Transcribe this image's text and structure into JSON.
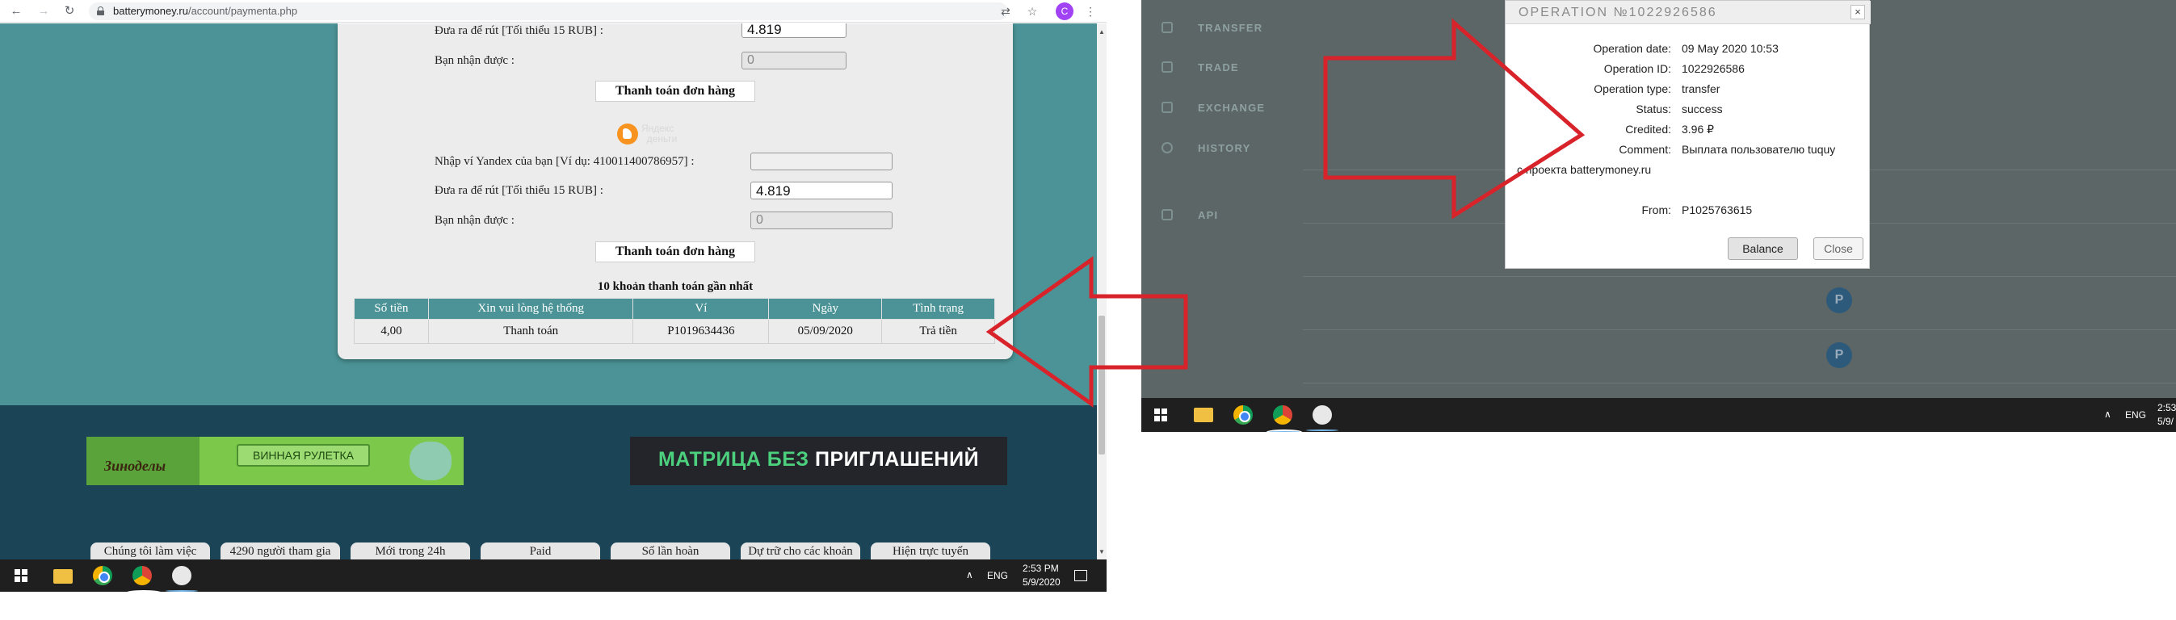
{
  "left_screen": {
    "browser": {
      "url_host": "batterymoney.ru",
      "url_path": "/account/paymenta.php",
      "profile_initial": "C"
    },
    "form_top": {
      "withdraw_label": "Đưa ra để rút [Tối thiểu 15 RUB] :",
      "withdraw_value": "4.819",
      "receive_label": "Bạn nhận được :",
      "receive_value": "0",
      "pay_button": "Thanh toán đơn hàng"
    },
    "yandex": {
      "logo_line1": "Яндекс",
      "logo_line2": "деньги",
      "wallet_label": "Nhập ví Yandex của bạn [Ví dụ: 410011400786957] :",
      "wallet_value": "",
      "withdraw_label": "Đưa ra để rút [Tối thiểu 15 RUB] :",
      "withdraw_value": "4.819",
      "receive_label": "Bạn nhận được :",
      "receive_value": "0",
      "pay_button": "Thanh toán đơn hàng"
    },
    "recent": {
      "title": "10 khoản thanh toán gần nhất",
      "columns": [
        "Số tiền",
        "Xin vui lòng hệ thống",
        "Ví",
        "Ngày",
        "Tình trạng"
      ],
      "rows": [
        [
          "4,00",
          "Thanh toán",
          "P1019634436",
          "05/09/2020",
          "Trả tiền"
        ]
      ]
    },
    "banners": {
      "b1_logo": "Зиноделы",
      "b1_button": "ВИННАЯ РУЛЕТКА",
      "b2_part1": "МАТРИЦА БЕЗ ",
      "b2_part2": "ПРИГЛАШЕНИЙ"
    },
    "footer_tabs": [
      "Chúng tôi làm việc",
      "4290 người tham gia",
      "Mới trong 24h",
      "Paid",
      "Số lần hoàn",
      "Dự trữ cho các khoản",
      "Hiện trực tuyến"
    ],
    "taskbar": {
      "lang": "ENG",
      "time": "2:53 PM",
      "date": "5/9/2020"
    }
  },
  "right_screen": {
    "sidebar": [
      "TRANSFER",
      "TRADE",
      "EXCHANGE",
      "HISTORY",
      "API"
    ],
    "modal": {
      "title": "OPERATION №1022926586",
      "close_glyph": "×",
      "fields": [
        {
          "label": "Operation date:",
          "value": "09 May 2020 10:53"
        },
        {
          "label": "Operation ID:",
          "value": "1022926586"
        },
        {
          "label": "Operation type:",
          "value": "transfer"
        },
        {
          "label": "Status:",
          "value": "success"
        },
        {
          "label": "Credited:",
          "value": "3.96 ₽"
        },
        {
          "label": "Comment:",
          "value": "Выплата пользователю tuquy"
        }
      ],
      "comment_line2": "с проекта batterymoney.ru",
      "from_label": "From:",
      "from_value": "P1025763615",
      "balance_button": "Balance",
      "close_button": "Close"
    },
    "taskbar": {
      "lang": "ENG",
      "time": "2:53",
      "date": "5/9/"
    }
  },
  "colors": {
    "teal_bg": "#4b9396",
    "footer_bg": "#1b4456",
    "annotation_red": "#d9232a",
    "right_bg": "#5c6666"
  }
}
